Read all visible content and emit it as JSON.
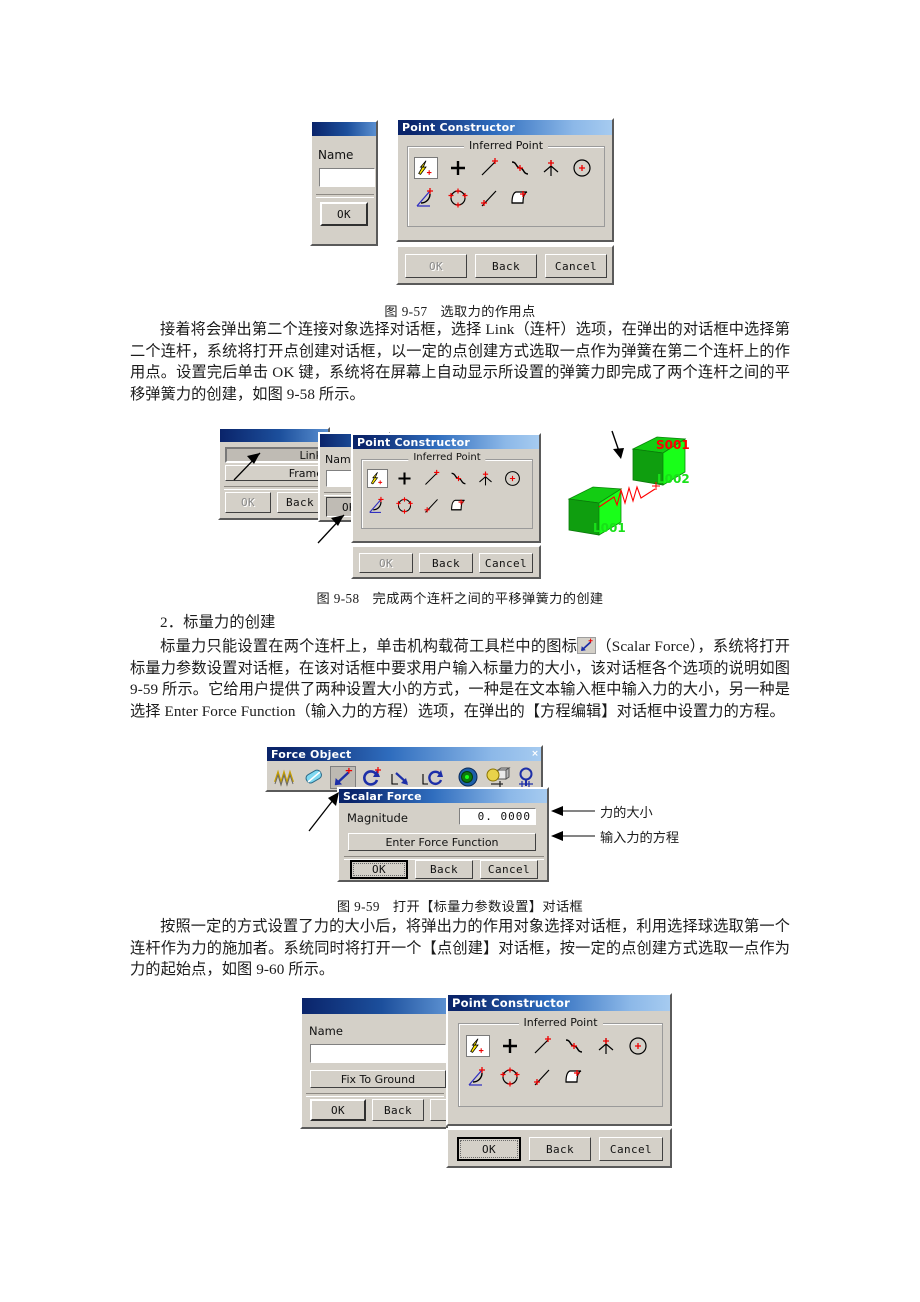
{
  "document": {
    "language": "zh-CN",
    "page_bg": "#ffffff"
  },
  "figures": {
    "fig57": {
      "caption_no": "图 9-57",
      "caption_text": "选取力的作用点",
      "name_dialog": {
        "label_name": "Name",
        "value": "",
        "ok_label": "OK"
      },
      "point_constructor": {
        "title": "Point Constructor",
        "group_legend": "Inferred Point",
        "icons_row1": [
          "inferred-point-icon",
          "cursor-location-icon",
          "existing-point-icon",
          "end-point-icon",
          "control-point-icon",
          "arc-center-icon"
        ],
        "icons_row2": [
          "arc-angle-icon",
          "quadrant-point-icon",
          "point-on-curve-icon",
          "point-on-face-icon"
        ],
        "buttons": [
          "OK",
          "Back",
          "Cancel"
        ],
        "ok_disabled": true
      }
    },
    "fig58": {
      "caption_no": "图 9-58",
      "caption_text": "完成两个连杆之间的平移弹簧力的创建",
      "select_dialog": {
        "link_label": "Link",
        "frame_label": "Frame",
        "ok_label": "OK",
        "back_label": "Back",
        "ok_disabled": true
      },
      "name_dialog": {
        "label_name": "Name",
        "value": "",
        "ok_label": "OK"
      },
      "point_constructor": {
        "title": "Point Constructor",
        "group_legend": "Inferred Point",
        "buttons": [
          "OK",
          "Back",
          "Cancel"
        ]
      },
      "viewport": {
        "spring_label": "S001",
        "link2_label": "L002",
        "link1_label": "L001",
        "body_color": "#00e000",
        "spring_color": "#ff0000"
      }
    },
    "fig59": {
      "caption_no": "图 9-59",
      "caption_text": "打开【标量力参数设置】对话框",
      "toolbar": {
        "title": "Force Object",
        "close_glyph": "×",
        "icons": [
          "spring-force-icon",
          "damper-force-icon",
          "scalar-force-icon",
          "torque-icon",
          "vector-force-icon",
          "vector-torque-icon",
          "gravity-icon",
          "contact-icon",
          "joint-friction-icon"
        ],
        "active_index": 2
      },
      "scalar_force": {
        "title": "Scalar Force",
        "magnitude_label": "Magnitude",
        "magnitude_value": "0. 0000",
        "function_button": "Enter Force Function",
        "buttons": [
          "OK",
          "Back",
          "Cancel"
        ]
      },
      "annotations": {
        "magnitude_note": "力的大小",
        "function_note": "输入力的方程"
      }
    },
    "fig60": {
      "name_dialog": {
        "label_name": "Name",
        "value": "",
        "fix_to_ground": "Fix To Ground",
        "ok_label": "OK",
        "back_label": "Back",
        "cancel_label": "C"
      },
      "point_constructor": {
        "title": "Point Constructor",
        "group_legend": "Inferred Point",
        "buttons": [
          "OK",
          "Back",
          "Cancel"
        ]
      }
    }
  },
  "body": {
    "para1": "接着将会弹出第二个连接对象选择对话框，选择 Link（连杆）选项，在弹出的对话框中选择第二个连杆，系统将打开点创建对话框，以一定的点创建方式选取一点作为弹簧在第二个连杆上的作用点。设置完后单击 OK 键，系统将在屏幕上自动显示所设置的弹簧力即完成了两个连杆之间的平移弹簧力的创建，如图 9-58 所示。",
    "heading2": "2．标量力的创建",
    "para2_a": "标量力只能设置在两个连杆上，单击机构载荷工具栏中的图标",
    "para2_b": "（Scalar Force），系统将打开标量力参数设置对话框，在该对话框中要求用户输入标量力的大小，该对话框各个选项的说明如图 9-59 所示。它给用户提供了两种设置大小的方式，一种是在文本输入框中输入力的大小，另一种是选择 Enter Force Function（输入力的方程）选项，在弹出的【方程编辑】对话框中设置力的方程。",
    "para3": "按照一定的方式设置了力的大小后，将弹出力的作用对象选择对话框，利用选择球选取第一个连杆作为力的施加者。系统同时将打开一个【点创建】对话框，按一定的点创建方式选取一点作为力的起始点，如图 9-60 所示。"
  }
}
